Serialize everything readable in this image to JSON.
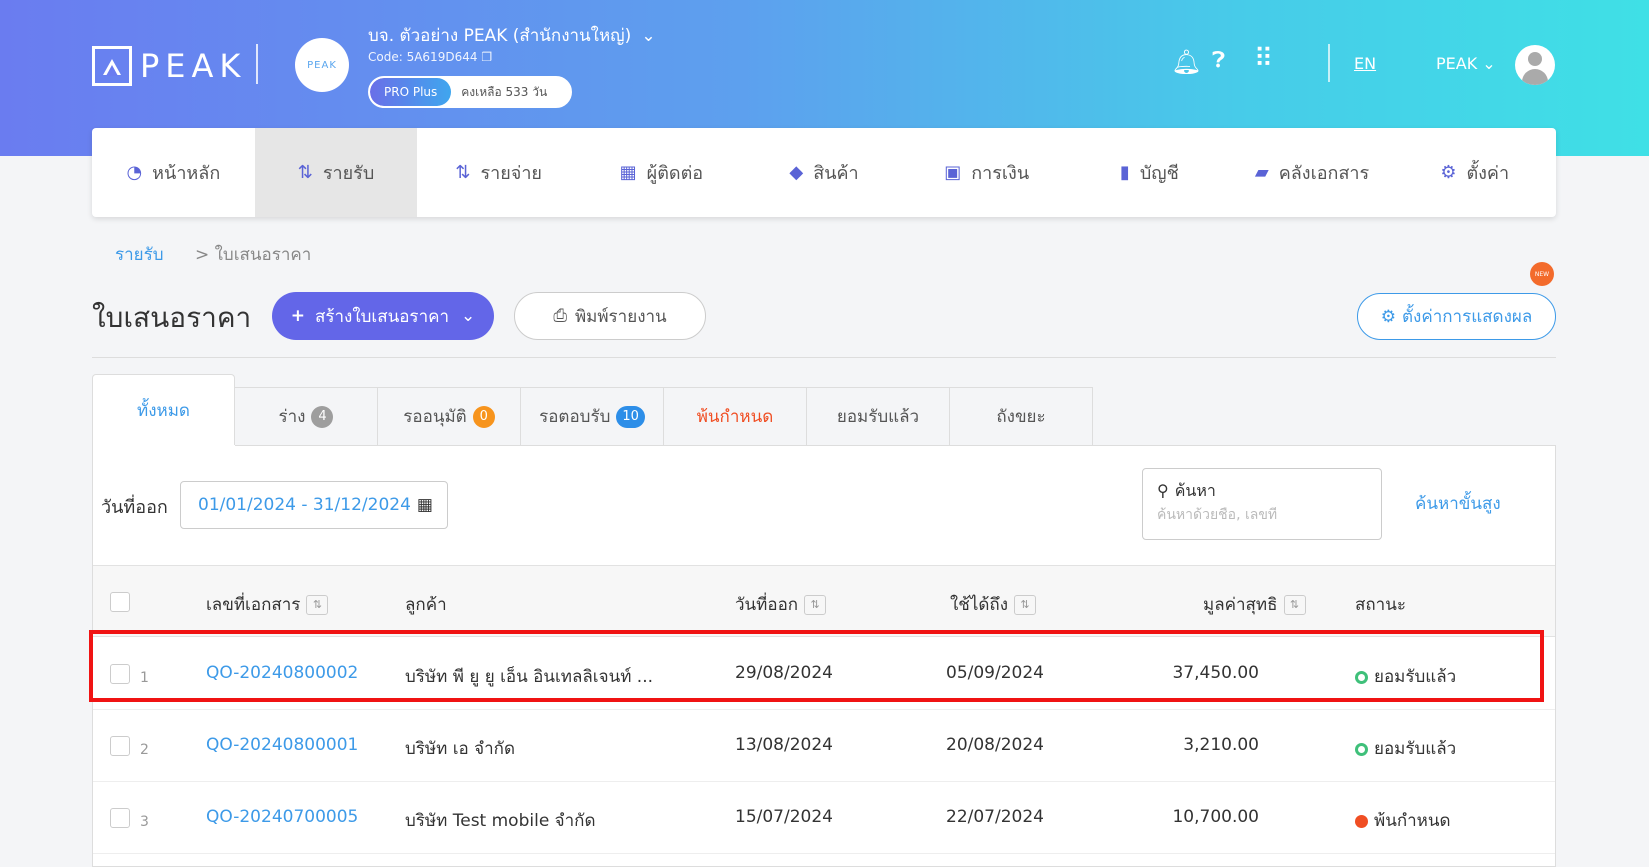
{
  "header": {
    "logo_text": "PEAK",
    "company_avatar_text": "PEAK",
    "company_name": "บจ. ตัวอย่าง PEAK (สำนักงานใหญ่)",
    "company_code": "Code: 5A619D644",
    "plan_label": "PRO Plus",
    "plan_remaining": "คงเหลือ 533 วัน",
    "language": "EN",
    "user_name": "PEAK"
  },
  "menu": [
    {
      "label": "หน้าหลัก",
      "icon": "dashboard-icon"
    },
    {
      "label": "รายรับ",
      "icon": "income-icon",
      "active": true
    },
    {
      "label": "รายจ่าย",
      "icon": "expense-icon"
    },
    {
      "label": "ผู้ติดต่อ",
      "icon": "contacts-icon"
    },
    {
      "label": "สินค้า",
      "icon": "box-icon"
    },
    {
      "label": "การเงิน",
      "icon": "money-icon"
    },
    {
      "label": "บัญชี",
      "icon": "book-icon"
    },
    {
      "label": "คลังเอกสาร",
      "icon": "folder-icon"
    },
    {
      "label": "ตั้งค่า",
      "icon": "gear-icon"
    }
  ],
  "breadcrumb": {
    "parent": "รายรับ",
    "separator": ">",
    "current": "ใบเสนอราคา"
  },
  "page_title": "ใบเสนอราคา",
  "actions": {
    "create_label": "สร้างใบเสนอราคา",
    "print_label": "พิมพ์รายงาน",
    "display_settings_label": "ตั้งค่าการแสดงผล",
    "new_badge": "NEW"
  },
  "tabs": [
    {
      "label": "ทั้งหมด",
      "count": null,
      "active": true
    },
    {
      "label": "ร่าง",
      "count": "4",
      "color": "#9e9e9e"
    },
    {
      "label": "รออนุมัติ",
      "count": "0",
      "color": "#f7941d"
    },
    {
      "label": "รอตอบรับ",
      "count": "10",
      "color": "#2d8ee8"
    },
    {
      "label": "พ้นกำหนด",
      "count": null,
      "color": "#f04e23"
    },
    {
      "label": "ยอมรับแล้ว",
      "count": null
    },
    {
      "label": "ถังขยะ",
      "count": null
    }
  ],
  "filters": {
    "date_label": "วันที่ออก",
    "date_range": "01/01/2024 - 31/12/2024",
    "search_label": "ค้นหา",
    "search_placeholder": "ค้นหาด้วยชื่อ, เลขที่",
    "advanced_search": "ค้นหาขั้นสูง"
  },
  "table": {
    "columns": [
      "เลขที่เอกสาร",
      "ลูกค้า",
      "วันที่ออก",
      "ใช้ได้ถึง",
      "มูลค่าสุทธิ",
      "สถานะ"
    ],
    "rows": [
      {
        "n": "1",
        "doc": "QO-20240800002",
        "customer": "บริษัท พี ยู ยู เอ็น อินเทลลิเจนท์ ...",
        "issue": "29/08/2024",
        "valid": "05/09/2024",
        "amount": "37,450.00",
        "status": "ยอมรับแล้ว",
        "status_type": "accepted"
      },
      {
        "n": "2",
        "doc": "QO-20240800001",
        "customer": "บริษัท เอ จำกัด",
        "issue": "13/08/2024",
        "valid": "20/08/2024",
        "amount": "3,210.00",
        "status": "ยอมรับแล้ว",
        "status_type": "accepted"
      },
      {
        "n": "3",
        "doc": "QO-20240700005",
        "customer": "บริษัท Test mobile จำกัด",
        "issue": "15/07/2024",
        "valid": "22/07/2024",
        "amount": "10,700.00",
        "status": "พ้นกำหนด",
        "status_type": "overdue"
      }
    ]
  },
  "colors": {
    "primary": "#6366e8",
    "link": "#3d9ae8",
    "accepted": "#3fc07a",
    "overdue": "#f04e23",
    "highlight": "#f01313"
  }
}
